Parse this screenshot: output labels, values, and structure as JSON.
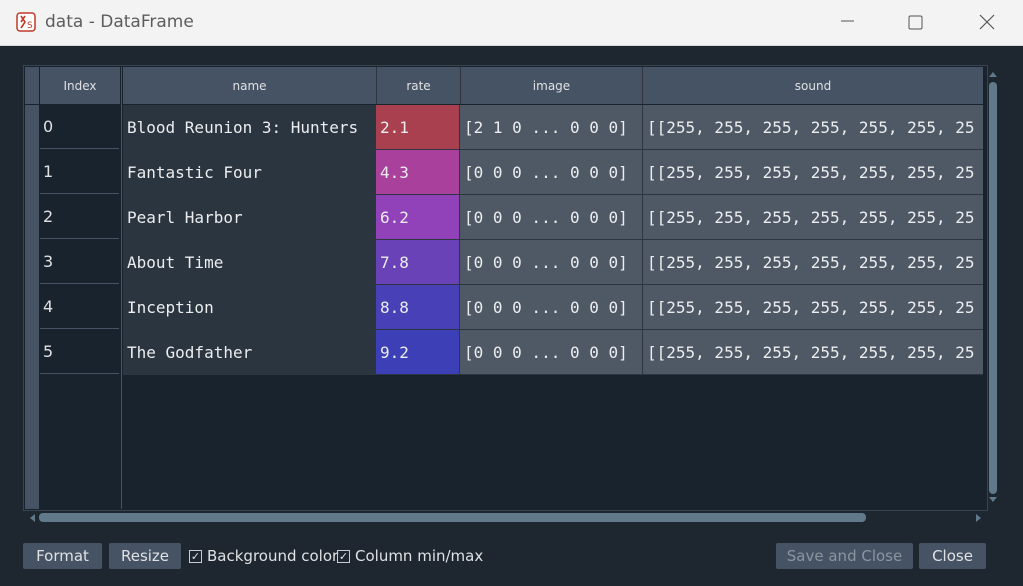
{
  "window": {
    "title": "data - DataFrame"
  },
  "table": {
    "index_header": "Index",
    "columns": [
      "name",
      "rate",
      "image",
      "sound"
    ],
    "rows": [
      {
        "index": "0",
        "name": "Blood Reunion 3: Hunters",
        "rate": "2.1",
        "image": "[2 1 0 ... 0 0 0]",
        "sound": "[[255, 255, 255, 255, 255, 255, 25"
      },
      {
        "index": "1",
        "name": "Fantastic Four",
        "rate": "4.3",
        "image": "[0 0 0 ... 0 0 0]",
        "sound": "[[255, 255, 255, 255, 255, 255, 25"
      },
      {
        "index": "2",
        "name": "Pearl Harbor",
        "rate": "6.2",
        "image": "[0 0 0 ... 0 0 0]",
        "sound": "[[255, 255, 255, 255, 255, 255, 25"
      },
      {
        "index": "3",
        "name": "About Time",
        "rate": "7.8",
        "image": "[0 0 0 ... 0 0 0]",
        "sound": "[[255, 255, 255, 255, 255, 255, 25"
      },
      {
        "index": "4",
        "name": "Inception",
        "rate": "8.8",
        "image": "[0 0 0 ... 0 0 0]",
        "sound": "[[255, 255, 255, 255, 255, 255, 25"
      },
      {
        "index": "5",
        "name": "The Godfather",
        "rate": "9.2",
        "image": "[0 0 0 ... 0 0 0]",
        "sound": "[[255, 255, 255, 255, 255, 255, 25"
      }
    ],
    "rate_colors": [
      "#a9404f",
      "#a8409c",
      "#9242b8",
      "#6942b7",
      "#4740b6",
      "#3c3fb5"
    ]
  },
  "footer": {
    "format_label": "Format",
    "resize_label": "Resize",
    "background_color_label": "Background color",
    "background_color_checked": true,
    "column_minmax_label": "Column min/max",
    "column_minmax_checked": true,
    "save_close_label": "Save and Close",
    "close_label": "Close"
  },
  "icons": [
    "spyder-app-icon",
    "minimize-icon",
    "maximize-icon",
    "close-icon"
  ]
}
